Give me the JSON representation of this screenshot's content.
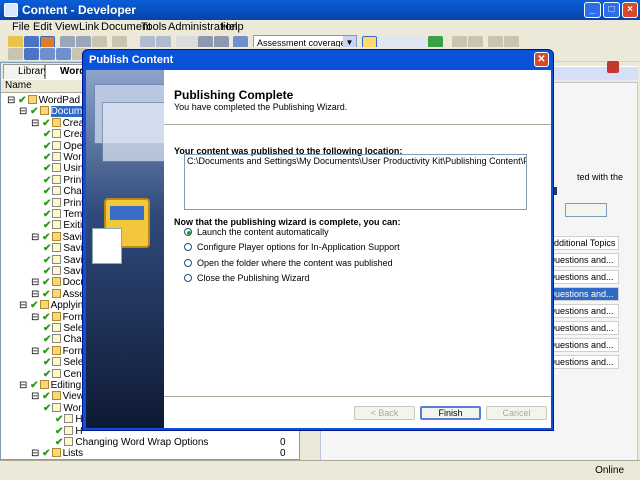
{
  "window": {
    "title": "Content - Developer"
  },
  "menu": [
    "File",
    "Edit",
    "View",
    "Link",
    "Document",
    "Tools",
    "Administration",
    "Help"
  ],
  "toolbar": {
    "view_select": "Assessment coverage view"
  },
  "library": {
    "tabs": [
      "Library",
      "Word"
    ],
    "column_header": "Name",
    "tree": [
      {
        "label": "WordPad Training",
        "level": 0
      },
      {
        "label": "Document Ba",
        "level": 1,
        "selected": true
      },
      {
        "label": "Creating a",
        "level": 2
      },
      {
        "label": "Creat",
        "level": 3
      },
      {
        "label": "Openi",
        "level": 3
      },
      {
        "label": "Wordi",
        "level": 3
      },
      {
        "label": "Using",
        "level": 3
      },
      {
        "label": "Print F",
        "level": 3
      },
      {
        "label": "Chang",
        "level": 3
      },
      {
        "label": "Printin",
        "level": 3
      },
      {
        "label": "Templ",
        "level": 3
      },
      {
        "label": "Exitin",
        "level": 3
      },
      {
        "label": "Saving Do",
        "level": 2
      },
      {
        "label": "Savin",
        "level": 3
      },
      {
        "label": "Savin",
        "level": 3
      },
      {
        "label": "Savin",
        "level": 3
      },
      {
        "label": "Document",
        "level": 2
      },
      {
        "label": "Assessme",
        "level": 2
      },
      {
        "label": "Applying Form",
        "level": 1
      },
      {
        "label": "Formattin",
        "level": 2
      },
      {
        "label": "Select",
        "level": 3
      },
      {
        "label": "Chang",
        "level": 3
      },
      {
        "label": "Formattin",
        "level": 2
      },
      {
        "label": "Select",
        "level": 3
      },
      {
        "label": "Cente",
        "level": 3
      },
      {
        "label": "Editing Basics",
        "level": 1
      },
      {
        "label": "Views and",
        "level": 2
      },
      {
        "label": "Work",
        "level": 3
      },
      {
        "label": "H",
        "level": 4
      },
      {
        "label": "H",
        "level": 4
      },
      {
        "label": "Changing Word Wrap Options",
        "level": 4,
        "count": "0"
      },
      {
        "label": "Lists",
        "level": 2,
        "count": "0"
      }
    ]
  },
  "right_pane": {
    "partial_text": "ted with the",
    "rows": [
      "nt/Additional Topics",
      "nt/Questions and...",
      "nt/Questions and...",
      "nt/Questions and...",
      "nt/Questions and...",
      "nt/Questions and...",
      "nt/Questions and...",
      "nt/Questions and..."
    ]
  },
  "statusbar": {
    "online": "Online"
  },
  "dialog": {
    "title": "Publish Content",
    "heading": "Publishing Complete",
    "subheading": "You have completed the Publishing Wizard.",
    "location_label": "Your content was published to the following location:",
    "location_path": "C:\\Documents and Settings\\My Documents\\User Productivity Kit\\Publishing Content\\PlayerPackage",
    "options_label": "Now that the publishing wizard is complete, you can:",
    "options": [
      {
        "label": "Launch the content automatically",
        "checked": true
      },
      {
        "label": "Configure Player options for In-Application Support",
        "checked": false
      },
      {
        "label": "Open the folder where the content was published",
        "checked": false
      },
      {
        "label": "Close the Publishing Wizard",
        "checked": false
      }
    ],
    "buttons": {
      "back": "< Back",
      "finish": "Finish",
      "cancel": "Cancel"
    }
  }
}
